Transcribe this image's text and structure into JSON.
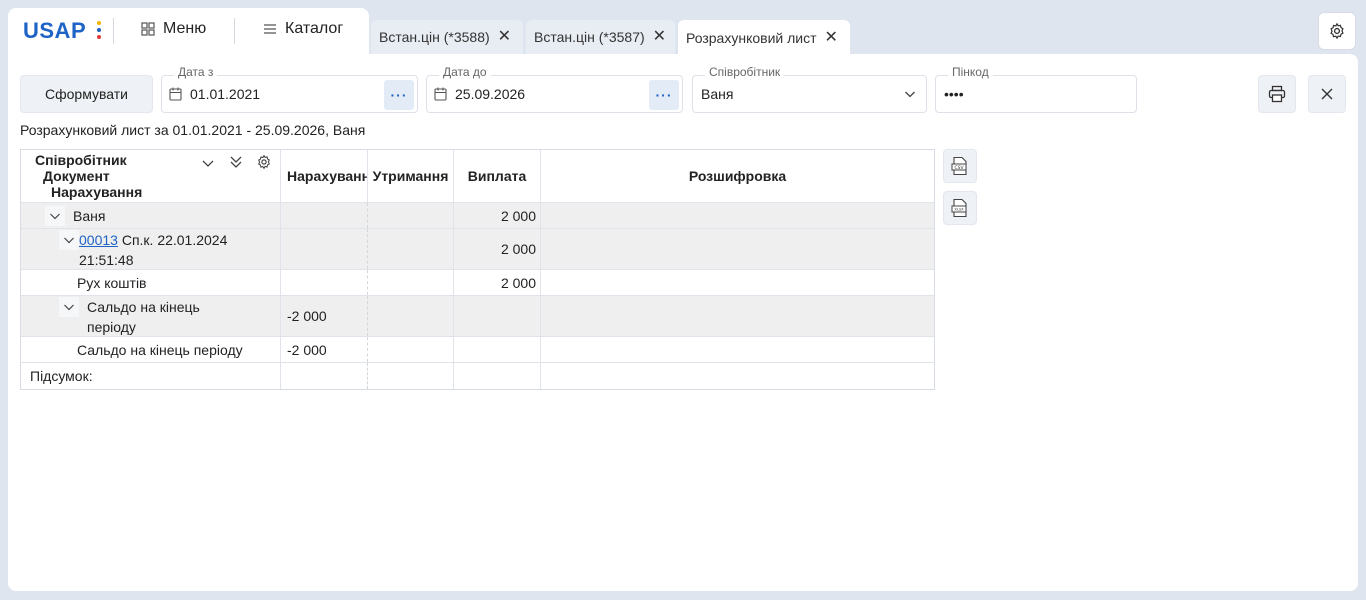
{
  "logo": {
    "text": "USAP",
    "dot_colors": [
      "#f4b400",
      "#1e63c6",
      "#e53935"
    ]
  },
  "nav": {
    "menu_label": "Меню",
    "catalog_label": "Каталог"
  },
  "tabs": [
    {
      "label": "Встан.цін (*3588)",
      "active": false
    },
    {
      "label": "Встан.цін (*3587)",
      "active": false
    },
    {
      "label": "Розрахунковий лист",
      "active": true
    }
  ],
  "toolbar": {
    "form_button": "Сформувати",
    "date_from": {
      "label": "Дата з",
      "value": "01.01.2021"
    },
    "date_to": {
      "label": "Дата до",
      "value": "25.09.2026"
    },
    "employee": {
      "label": "Співробітник",
      "value": "Ваня"
    },
    "pin": {
      "label": "Пінкод",
      "value": "••••"
    }
  },
  "caption": "Розрахунковий лист за 01.01.2021 - 25.09.2026, Ваня",
  "table": {
    "group_header": [
      "Співробітник",
      "Документ",
      "Нарахування"
    ],
    "columns": [
      "Нарахування",
      "Утримання",
      "Виплата",
      "Розшифровка"
    ],
    "rows": [
      {
        "label": "Ваня",
        "accrual": "",
        "deduction": "",
        "payment": "2 000"
      },
      {
        "doc_link": "00013",
        "label": "Сп.к. 22.01.2024 21:51:48",
        "accrual": "",
        "deduction": "",
        "payment": "2 000"
      },
      {
        "label": "Рух коштів",
        "accrual": "",
        "deduction": "",
        "payment": "2 000"
      },
      {
        "label": "Сальдо на кінець періоду",
        "accrual": "-2 000",
        "deduction": "",
        "payment": ""
      },
      {
        "label": "Сальдо на кінець періоду",
        "accrual": "-2 000",
        "deduction": "",
        "payment": ""
      }
    ],
    "total_label": "Підсумок:"
  },
  "export": {
    "csv": "CSV",
    "xlsx": "XLSX"
  },
  "colors": {
    "accent": "#1e63c6",
    "page_bg": "#dfe5ee"
  }
}
